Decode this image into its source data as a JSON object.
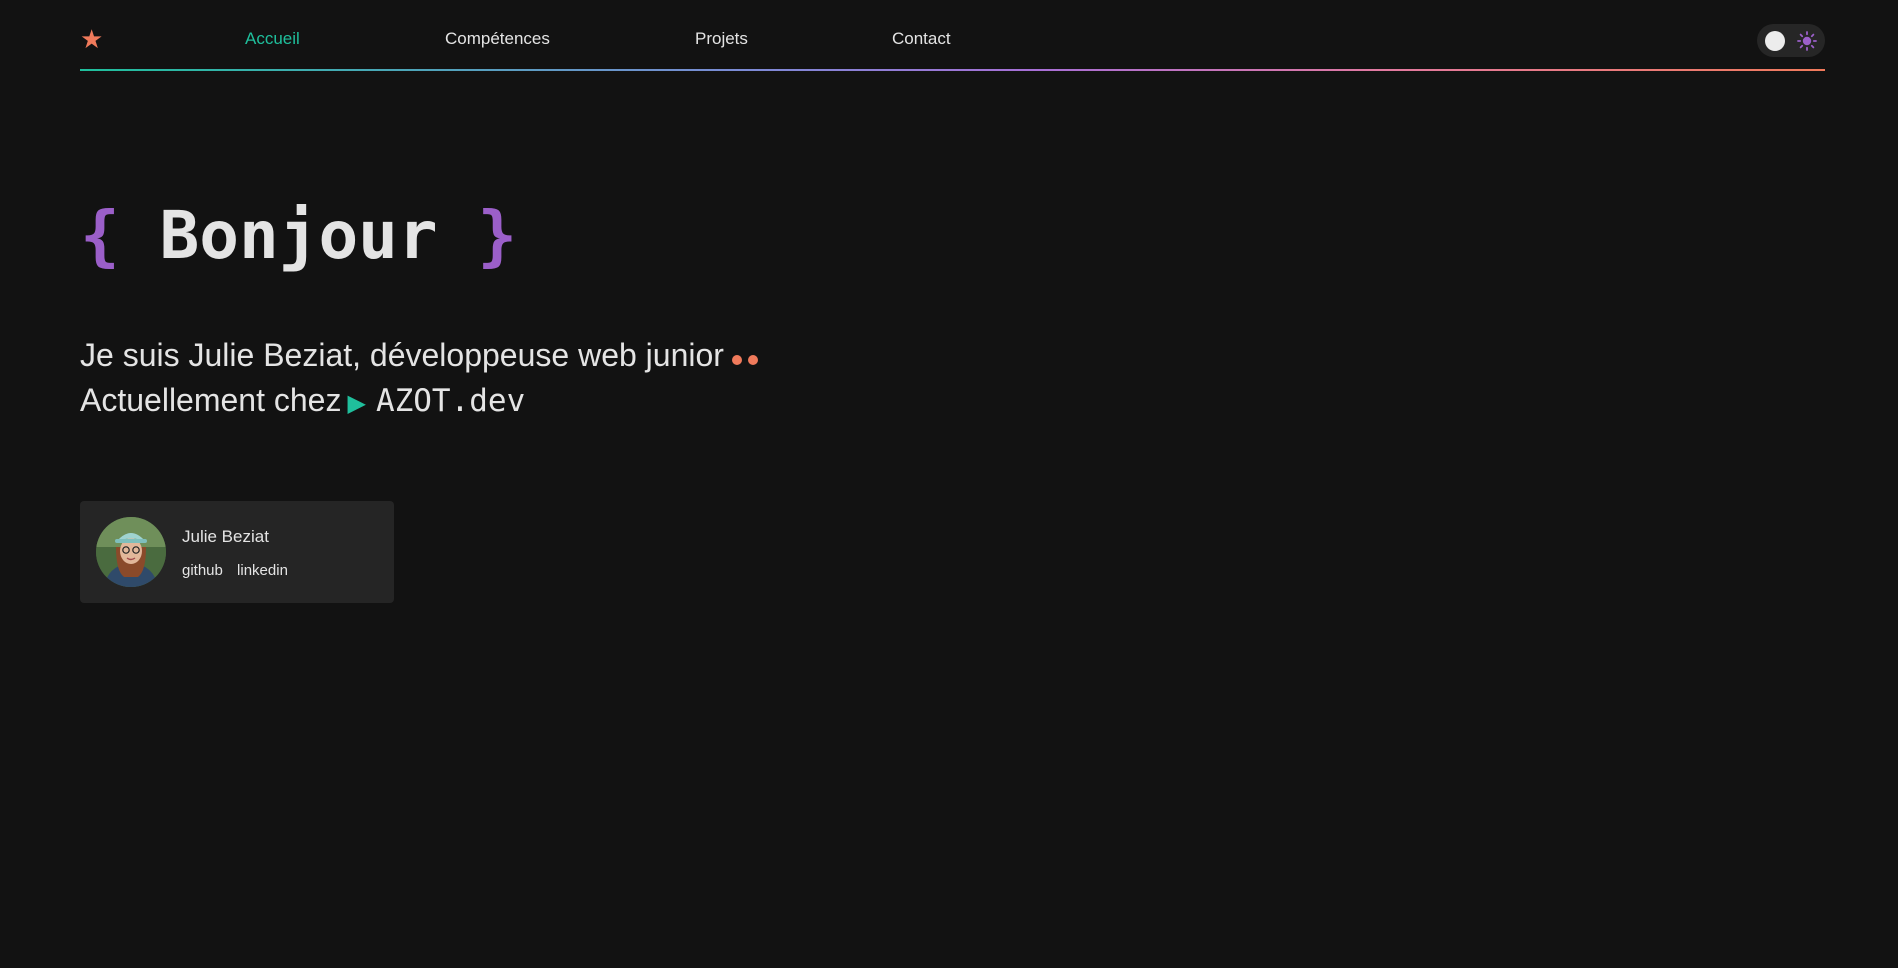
{
  "logo": {
    "glyph": "★",
    "color": "#f07a5b"
  },
  "nav": {
    "items": [
      {
        "label": "Accueil",
        "active": true
      },
      {
        "label": "Compétences",
        "active": false
      },
      {
        "label": "Projets",
        "active": false
      },
      {
        "label": "Contact",
        "active": false
      }
    ]
  },
  "theme_toggle": {
    "icon": "sun-icon",
    "state": "dark"
  },
  "hero": {
    "brace_open": "{",
    "title": "Bonjour",
    "brace_close": "}",
    "line1": "Je suis Julie Beziat, développeuse web junior",
    "line2": "Actuellement chez",
    "company": "AZOT.dev"
  },
  "profile": {
    "name": "Julie Beziat",
    "links": [
      "github",
      "linkedin"
    ]
  },
  "colors": {
    "background": "#121212",
    "accent_teal": "#1fbf9c",
    "accent_purple": "#9b5fc9",
    "accent_orange": "#f07a5b"
  }
}
